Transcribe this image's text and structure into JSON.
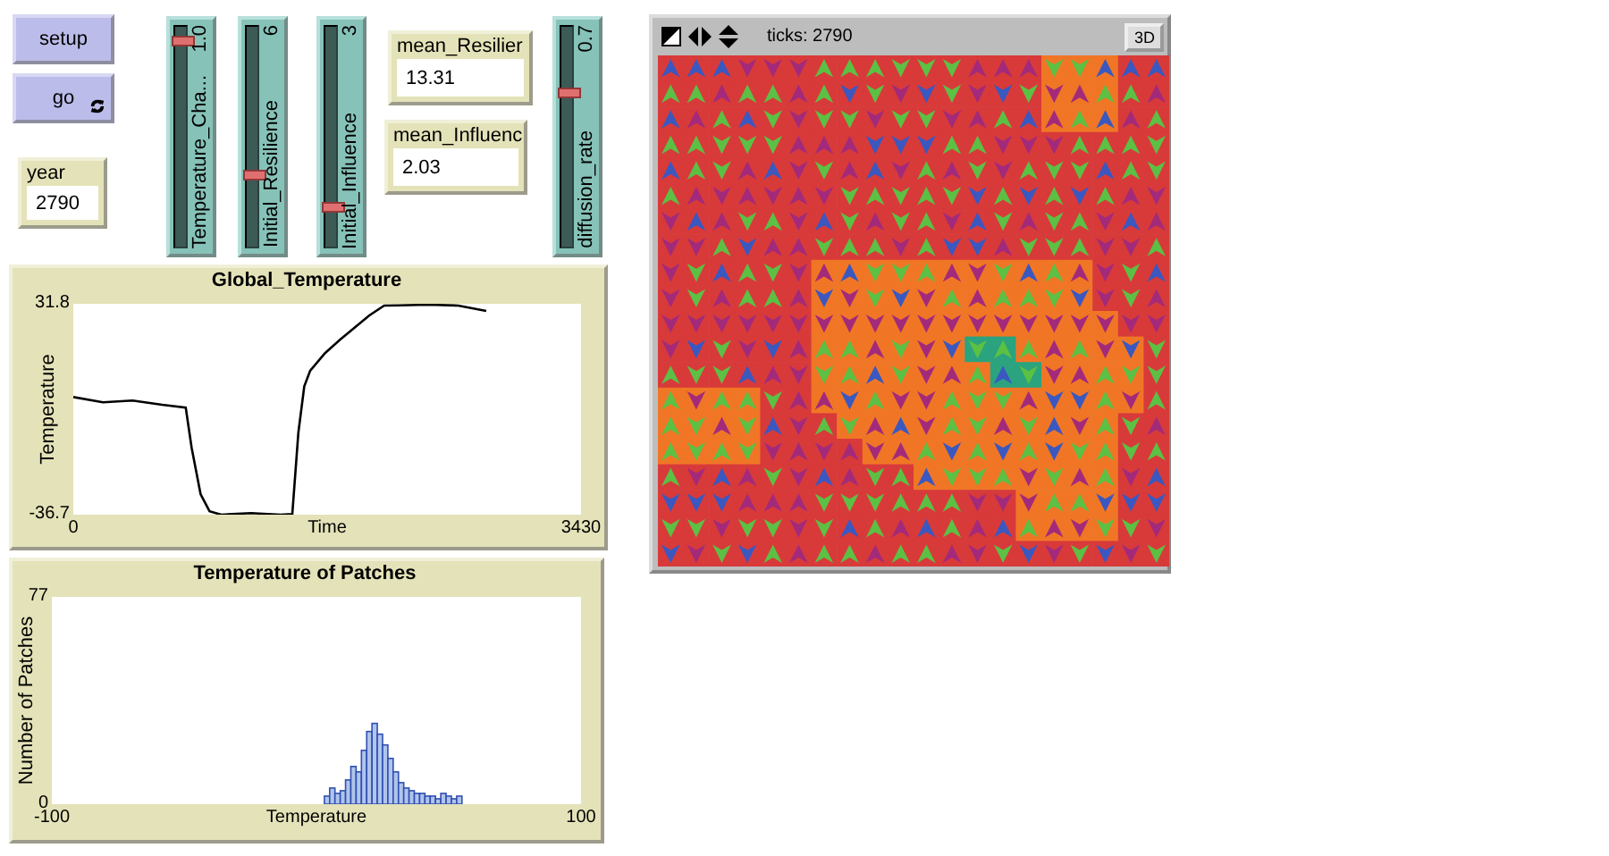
{
  "buttons": [
    {
      "label": "setup",
      "forever": false
    },
    {
      "label": "go",
      "forever": true
    }
  ],
  "monitors": [
    {
      "label": "year",
      "value": "2790"
    },
    {
      "label": "mean_Resilier",
      "value": "13.31"
    },
    {
      "label": "mean_Influenc",
      "value": "2.03"
    }
  ],
  "sliders": [
    {
      "label": "Temperature_Cha...",
      "value": "1.0",
      "level": 1.0
    },
    {
      "label": "Initial_Resilience",
      "value": "6",
      "level": 0.33
    },
    {
      "label": "Initial_Influence",
      "value": "3",
      "level": 0.17
    },
    {
      "label": "diffusion_rate",
      "value": "0.7",
      "level": 0.74
    }
  ],
  "plots": [
    {
      "chart_data": {
        "type": "line",
        "title": "Global_Temperature",
        "xlabel": "Time",
        "ylabel": "Temperature",
        "xlim": [
          0,
          3430
        ],
        "ylim": [
          -36.7,
          31.8
        ],
        "xticks": [
          {
            "value": 0,
            "label": "0"
          },
          {
            "value": 3430,
            "label": "3430"
          }
        ],
        "yticks": [
          {
            "value": -36.7,
            "label": "-36.7"
          },
          {
            "value": 31.8,
            "label": "31.8"
          }
        ],
        "x": [
          0,
          200,
          400,
          600,
          760,
          800,
          860,
          920,
          1000,
          1200,
          1400,
          1480,
          1520,
          1560,
          1600,
          1700,
          1800,
          1900,
          2000,
          2100,
          2200,
          2400,
          2600,
          2790
        ],
        "series": [
          {
            "color": "#000000",
            "values": [
              1.5,
              -0.2,
              0.4,
              -1.0,
              -1.9,
              -15,
              -30,
              -35.6,
              -36.7,
              -36.2,
              -36.7,
              -36.5,
              -10,
              5,
              10.1,
              15.8,
              20,
              24,
              28,
              31.2,
              31.3,
              31.5,
              31.2,
              29.5
            ]
          }
        ]
      }
    },
    {
      "chart_data": {
        "type": "bar",
        "title": "Temperature of Patches",
        "xlabel": "Temperature",
        "ylabel": "Number of Patches",
        "xlim": [
          -100,
          100
        ],
        "ylim": [
          0,
          77
        ],
        "xticks": [
          {
            "value": -100,
            "label": "-100"
          },
          {
            "value": 100,
            "label": "100"
          }
        ],
        "yticks": [
          {
            "value": 0,
            "label": "0"
          },
          {
            "value": 77,
            "label": "77"
          }
        ],
        "x": [
          4,
          6,
          8,
          10,
          12,
          14,
          16,
          18,
          20,
          22,
          24,
          26,
          28,
          30,
          32,
          34,
          36,
          38,
          40,
          42,
          44,
          46,
          48,
          50,
          52,
          54
        ],
        "series": [
          {
            "color": "#3050b0",
            "values": [
              3,
              6,
              4,
              5,
              9,
              14,
              12,
              20,
              27,
              30,
              26,
              22,
              17,
              12,
              8,
              6,
              5,
              4,
              4,
              3,
              3,
              2,
              4,
              3,
              2,
              3
            ]
          }
        ]
      }
    }
  ],
  "view": {
    "ticks": "ticks: 2790",
    "button": "3D"
  }
}
